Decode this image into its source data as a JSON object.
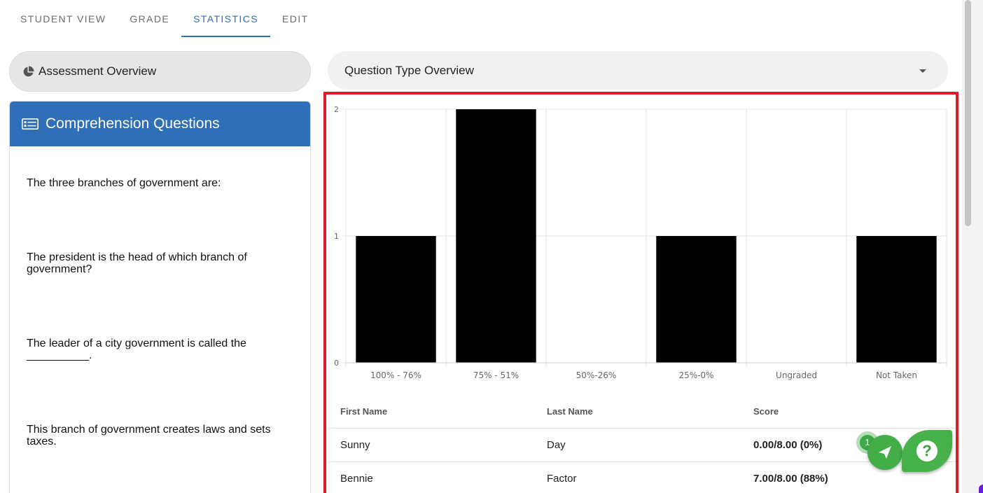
{
  "tabs": [
    {
      "label": "STUDENT VIEW",
      "active": false
    },
    {
      "label": "GRADE",
      "active": false
    },
    {
      "label": "STATISTICS",
      "active": true
    },
    {
      "label": "EDIT",
      "active": false
    }
  ],
  "overview_button": {
    "label": "Assessment Overview",
    "icon": "pie-chart-icon"
  },
  "questions_card": {
    "title": "Comprehension Questions",
    "icon": "card-list-icon",
    "questions": [
      "The three branches of government are:",
      "The president is the head of which branch of government?",
      "The leader of a city government is called the __________.",
      "This branch of government creates laws and sets taxes."
    ]
  },
  "dropdown": {
    "selected": "Question Type Overview"
  },
  "chart_data": {
    "type": "bar",
    "categories": [
      "100% - 76%",
      "75% - 51%",
      "50%-26%",
      "25%-0%",
      "Ungraded",
      "Not Taken"
    ],
    "values": [
      1,
      2,
      0,
      1,
      0,
      1
    ],
    "y_ticks": [
      "0",
      "1",
      "2"
    ],
    "ylim": [
      0,
      2
    ],
    "bar_color": "#000000",
    "grid": true
  },
  "table": {
    "headers": [
      "First Name",
      "Last Name",
      "Score"
    ],
    "rows": [
      [
        "Sunny",
        "Day",
        "0.00/8.00 (0%)"
      ],
      [
        "Bennie",
        "Factor",
        "7.00/8.00 (88%)"
      ]
    ]
  },
  "fab": {
    "badge": "1",
    "send_icon": "send-icon",
    "help_label": "?"
  },
  "colors": {
    "accent": "#2f6fb7",
    "highlight": "#d9202a",
    "fab_green": "#43ad48"
  }
}
